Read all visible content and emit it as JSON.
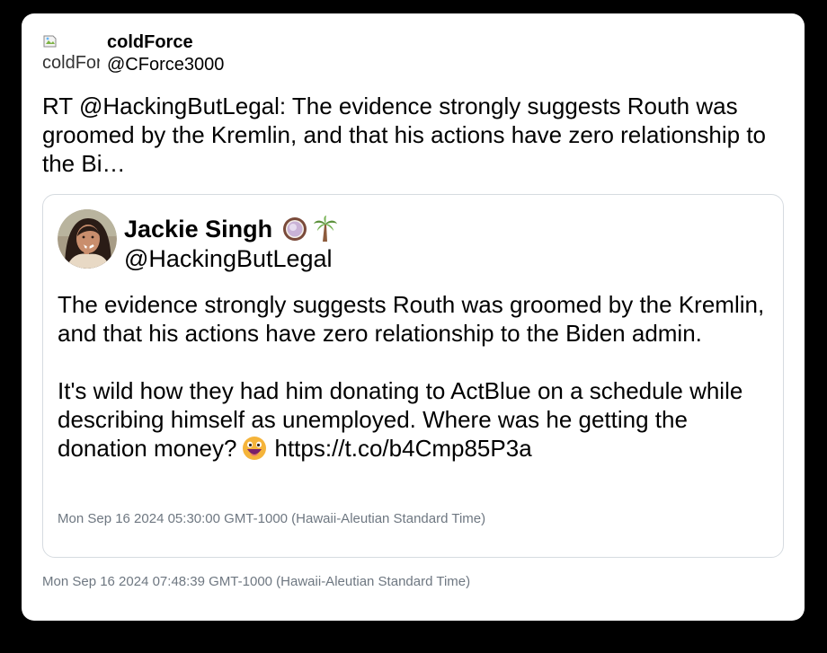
{
  "tweet": {
    "author": {
      "display_name": "coldForce",
      "handle": "@CForce3000",
      "avatar_alt": "coldForce"
    },
    "text": "RT @HackingButLegal: The evidence strongly suggests Routh was groomed by the Kremlin, and that his actions have zero relationship to the Bi…",
    "timestamp": "Mon Sep 16 2024 07:48:39 GMT-1000 (Hawaii-Aleutian Standard Time)"
  },
  "quoted_tweet": {
    "author": {
      "display_name": "Jackie Singh",
      "handle": "@HackingButLegal",
      "name_emojis": [
        "coconut-emoji",
        "palm-tree-emoji"
      ]
    },
    "paragraph_1": "The evidence strongly suggests Routh was groomed by the Kremlin, and that his actions have zero relationship to the Biden admin.",
    "paragraph_2": "It's wild how they had him donating to ActBlue on a schedule while describing himself as unemployed. Where was he getting the donation money?",
    "inline_emoji": "grinning-face-emoji",
    "link": "https://t.co/b4Cmp85P3a",
    "timestamp": "Mon Sep 16 2024 05:30:00 GMT-1000 (Hawaii-Aleutian Standard Time)"
  },
  "colors": {
    "background": "#000000",
    "card": "#ffffff",
    "border": "#d6dbe0",
    "timestamp": "#6e7781"
  }
}
